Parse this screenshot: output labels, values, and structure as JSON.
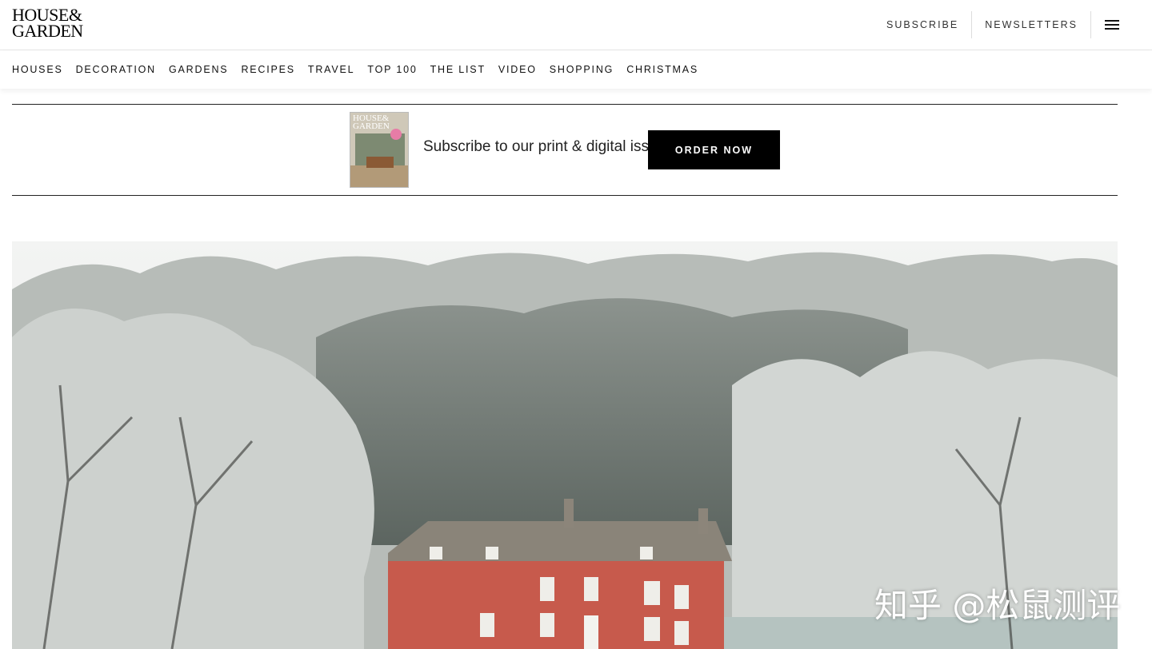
{
  "header": {
    "logo_line1": "HOUSE&",
    "logo_line2": "GARDEN",
    "subscribe_label": "SUBSCRIBE",
    "newsletters_label": "NEWSLETTERS",
    "menu_icon": "hamburger-menu-icon"
  },
  "nav": {
    "items": [
      {
        "label": "HOUSES"
      },
      {
        "label": "DECORATION"
      },
      {
        "label": "GARDENS"
      },
      {
        "label": "RECIPES"
      },
      {
        "label": "TRAVEL"
      },
      {
        "label": "TOP 100"
      },
      {
        "label": "THE LIST"
      },
      {
        "label": "VIDEO"
      },
      {
        "label": "SHOPPING"
      },
      {
        "label": "CHRISTMAS"
      }
    ]
  },
  "promo": {
    "cover_title_line1": "HOUSE&",
    "cover_title_line2": "GARDEN",
    "text": "Subscribe to our print & digital issue",
    "button_label": "ORDER NOW"
  },
  "watermark": {
    "text": "知乎 @松鼠测评"
  },
  "colors": {
    "button_bg": "#000000",
    "house_red": "#c75a4c",
    "frost": "#c9cdca"
  }
}
